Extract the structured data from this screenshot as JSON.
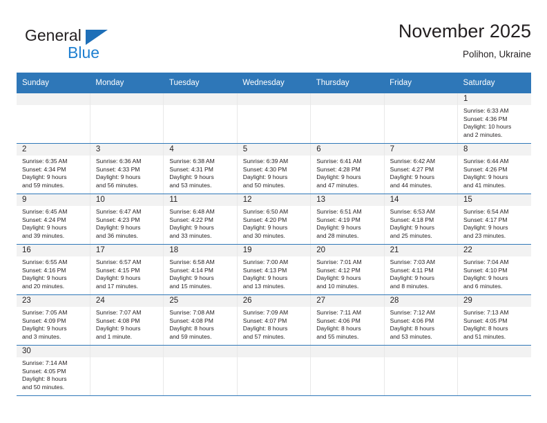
{
  "logo": {
    "word_one": "General",
    "word_two": "Blue",
    "triangle_icon": "triangle-icon",
    "accent_dark": "#1e6fb8",
    "accent_light": "#1e7fd0"
  },
  "header": {
    "title": "November 2025",
    "location": "Polihon, Ukraine",
    "band_color": "#2e77b8"
  },
  "calendar": {
    "weekdays": [
      "Sunday",
      "Monday",
      "Tuesday",
      "Wednesday",
      "Thursday",
      "Friday",
      "Saturday"
    ],
    "weeks": [
      [
        {
          "day": "",
          "lines": []
        },
        {
          "day": "",
          "lines": []
        },
        {
          "day": "",
          "lines": []
        },
        {
          "day": "",
          "lines": []
        },
        {
          "day": "",
          "lines": []
        },
        {
          "day": "",
          "lines": []
        },
        {
          "day": "1",
          "lines": [
            "Sunrise: 6:33 AM",
            "Sunset: 4:36 PM",
            "Daylight: 10 hours",
            "and 2 minutes."
          ]
        }
      ],
      [
        {
          "day": "2",
          "lines": [
            "Sunrise: 6:35 AM",
            "Sunset: 4:34 PM",
            "Daylight: 9 hours",
            "and 59 minutes."
          ]
        },
        {
          "day": "3",
          "lines": [
            "Sunrise: 6:36 AM",
            "Sunset: 4:33 PM",
            "Daylight: 9 hours",
            "and 56 minutes."
          ]
        },
        {
          "day": "4",
          "lines": [
            "Sunrise: 6:38 AM",
            "Sunset: 4:31 PM",
            "Daylight: 9 hours",
            "and 53 minutes."
          ]
        },
        {
          "day": "5",
          "lines": [
            "Sunrise: 6:39 AM",
            "Sunset: 4:30 PM",
            "Daylight: 9 hours",
            "and 50 minutes."
          ]
        },
        {
          "day": "6",
          "lines": [
            "Sunrise: 6:41 AM",
            "Sunset: 4:28 PM",
            "Daylight: 9 hours",
            "and 47 minutes."
          ]
        },
        {
          "day": "7",
          "lines": [
            "Sunrise: 6:42 AM",
            "Sunset: 4:27 PM",
            "Daylight: 9 hours",
            "and 44 minutes."
          ]
        },
        {
          "day": "8",
          "lines": [
            "Sunrise: 6:44 AM",
            "Sunset: 4:26 PM",
            "Daylight: 9 hours",
            "and 41 minutes."
          ]
        }
      ],
      [
        {
          "day": "9",
          "lines": [
            "Sunrise: 6:45 AM",
            "Sunset: 4:24 PM",
            "Daylight: 9 hours",
            "and 39 minutes."
          ]
        },
        {
          "day": "10",
          "lines": [
            "Sunrise: 6:47 AM",
            "Sunset: 4:23 PM",
            "Daylight: 9 hours",
            "and 36 minutes."
          ]
        },
        {
          "day": "11",
          "lines": [
            "Sunrise: 6:48 AM",
            "Sunset: 4:22 PM",
            "Daylight: 9 hours",
            "and 33 minutes."
          ]
        },
        {
          "day": "12",
          "lines": [
            "Sunrise: 6:50 AM",
            "Sunset: 4:20 PM",
            "Daylight: 9 hours",
            "and 30 minutes."
          ]
        },
        {
          "day": "13",
          "lines": [
            "Sunrise: 6:51 AM",
            "Sunset: 4:19 PM",
            "Daylight: 9 hours",
            "and 28 minutes."
          ]
        },
        {
          "day": "14",
          "lines": [
            "Sunrise: 6:53 AM",
            "Sunset: 4:18 PM",
            "Daylight: 9 hours",
            "and 25 minutes."
          ]
        },
        {
          "day": "15",
          "lines": [
            "Sunrise: 6:54 AM",
            "Sunset: 4:17 PM",
            "Daylight: 9 hours",
            "and 23 minutes."
          ]
        }
      ],
      [
        {
          "day": "16",
          "lines": [
            "Sunrise: 6:55 AM",
            "Sunset: 4:16 PM",
            "Daylight: 9 hours",
            "and 20 minutes."
          ]
        },
        {
          "day": "17",
          "lines": [
            "Sunrise: 6:57 AM",
            "Sunset: 4:15 PM",
            "Daylight: 9 hours",
            "and 17 minutes."
          ]
        },
        {
          "day": "18",
          "lines": [
            "Sunrise: 6:58 AM",
            "Sunset: 4:14 PM",
            "Daylight: 9 hours",
            "and 15 minutes."
          ]
        },
        {
          "day": "19",
          "lines": [
            "Sunrise: 7:00 AM",
            "Sunset: 4:13 PM",
            "Daylight: 9 hours",
            "and 13 minutes."
          ]
        },
        {
          "day": "20",
          "lines": [
            "Sunrise: 7:01 AM",
            "Sunset: 4:12 PM",
            "Daylight: 9 hours",
            "and 10 minutes."
          ]
        },
        {
          "day": "21",
          "lines": [
            "Sunrise: 7:03 AM",
            "Sunset: 4:11 PM",
            "Daylight: 9 hours",
            "and 8 minutes."
          ]
        },
        {
          "day": "22",
          "lines": [
            "Sunrise: 7:04 AM",
            "Sunset: 4:10 PM",
            "Daylight: 9 hours",
            "and 6 minutes."
          ]
        }
      ],
      [
        {
          "day": "23",
          "lines": [
            "Sunrise: 7:05 AM",
            "Sunset: 4:09 PM",
            "Daylight: 9 hours",
            "and 3 minutes."
          ]
        },
        {
          "day": "24",
          "lines": [
            "Sunrise: 7:07 AM",
            "Sunset: 4:08 PM",
            "Daylight: 9 hours",
            "and 1 minute."
          ]
        },
        {
          "day": "25",
          "lines": [
            "Sunrise: 7:08 AM",
            "Sunset: 4:08 PM",
            "Daylight: 8 hours",
            "and 59 minutes."
          ]
        },
        {
          "day": "26",
          "lines": [
            "Sunrise: 7:09 AM",
            "Sunset: 4:07 PM",
            "Daylight: 8 hours",
            "and 57 minutes."
          ]
        },
        {
          "day": "27",
          "lines": [
            "Sunrise: 7:11 AM",
            "Sunset: 4:06 PM",
            "Daylight: 8 hours",
            "and 55 minutes."
          ]
        },
        {
          "day": "28",
          "lines": [
            "Sunrise: 7:12 AM",
            "Sunset: 4:06 PM",
            "Daylight: 8 hours",
            "and 53 minutes."
          ]
        },
        {
          "day": "29",
          "lines": [
            "Sunrise: 7:13 AM",
            "Sunset: 4:05 PM",
            "Daylight: 8 hours",
            "and 51 minutes."
          ]
        }
      ],
      [
        {
          "day": "30",
          "lines": [
            "Sunrise: 7:14 AM",
            "Sunset: 4:05 PM",
            "Daylight: 8 hours",
            "and 50 minutes."
          ]
        },
        {
          "day": "",
          "lines": []
        },
        {
          "day": "",
          "lines": []
        },
        {
          "day": "",
          "lines": []
        },
        {
          "day": "",
          "lines": []
        },
        {
          "day": "",
          "lines": []
        },
        {
          "day": "",
          "lines": []
        }
      ]
    ]
  }
}
